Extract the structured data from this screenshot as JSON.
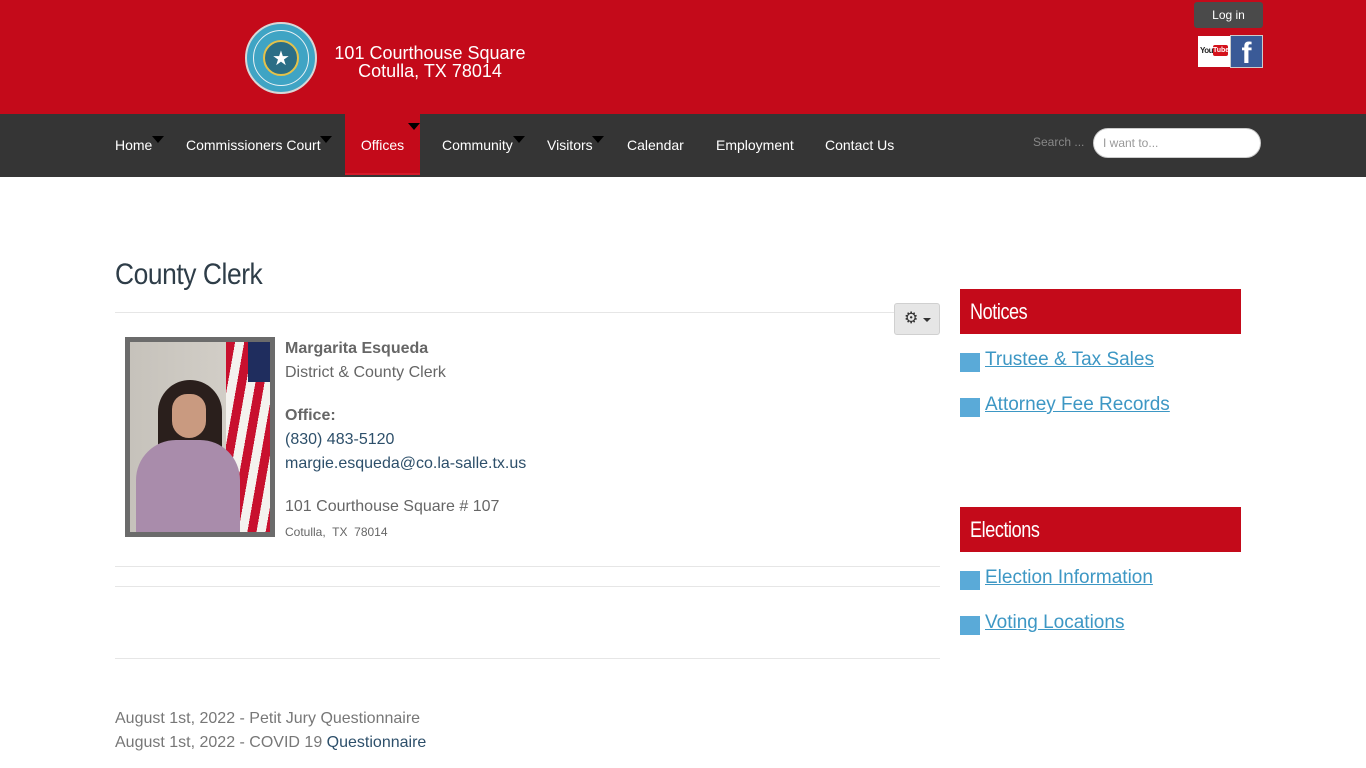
{
  "header": {
    "address_line1": "101 Courthouse Square",
    "address_line2": "Cotulla, TX 78014",
    "login_label": "Log in",
    "youtube_you": "You",
    "youtube_tube": "Tube",
    "facebook_glyph": "f",
    "seal_star": "★"
  },
  "nav": {
    "items": [
      {
        "label": "Home"
      },
      {
        "label": "Commissioners Court"
      },
      {
        "label": "Offices"
      },
      {
        "label": "Community"
      },
      {
        "label": "Visitors"
      },
      {
        "label": "Calendar"
      },
      {
        "label": "Employment"
      },
      {
        "label": "Contact Us"
      }
    ],
    "active": "Offices",
    "search_label": "Search ...",
    "search_placeholder": "I want to...",
    "search_value": ""
  },
  "main": {
    "title": "County Clerk",
    "gear_glyph": "⚙",
    "profile": {
      "name": "Margarita Esqueda",
      "role": "District & County Clerk",
      "office_label": "Office:",
      "phone": "(830) 483-5120",
      "email": "margie.esqueda@co.la-salle.tx.us",
      "address1": "101 Courthouse Square # 107",
      "address2": "Cotulla,  TX  78014"
    },
    "notices": [
      {
        "prefix": "August 1st, 2022 - Petit Jury Questionnaire",
        "link": ""
      },
      {
        "prefix": "August 1st, 2022 - COVID 19 ",
        "link": "Questionnaire"
      }
    ]
  },
  "sidebar": {
    "notices_title": "Notices",
    "notices_links": [
      "Trustee & Tax Sales",
      "Attorney Fee Records"
    ],
    "elections_title": "Elections",
    "elections_links": [
      "Election Information",
      "Voting Locations"
    ]
  },
  "colors": {
    "brand_red": "#c40a1a",
    "nav_dark": "#353535",
    "link_blue": "#3d97c4",
    "bullet_blue": "#5aaad8"
  }
}
